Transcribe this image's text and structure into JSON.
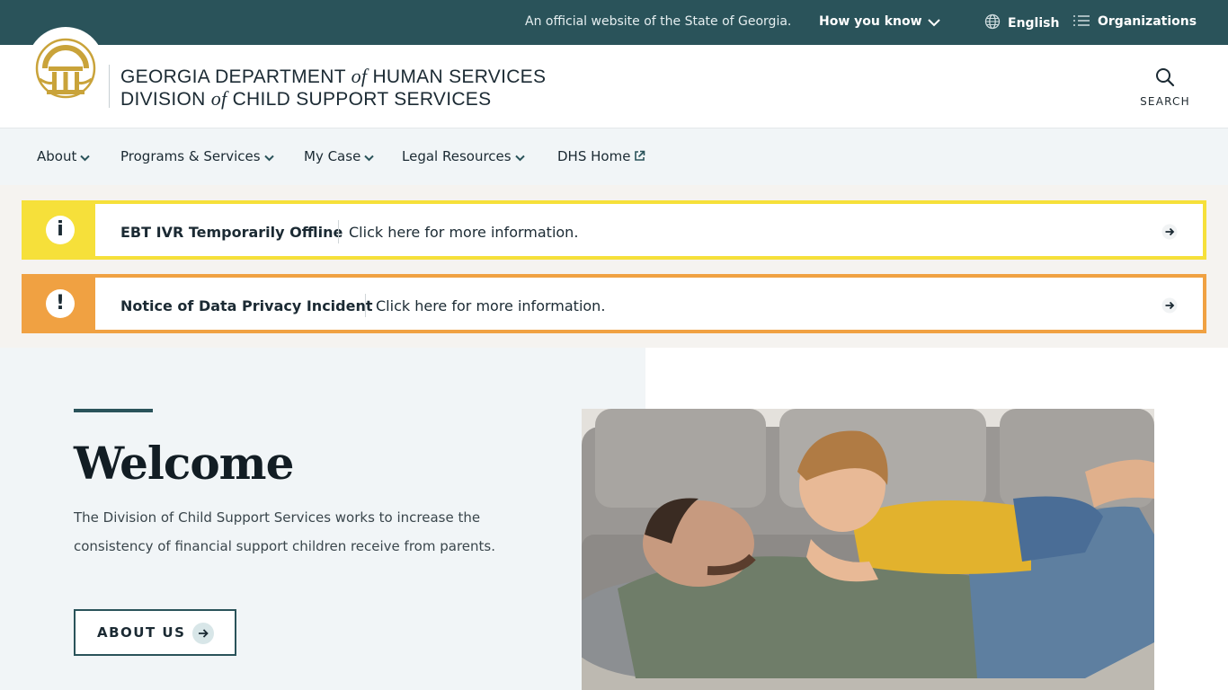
{
  "topbar": {
    "official_text": "An official website of the State of Georgia.",
    "how_you_know": "How you know",
    "language": "English",
    "organizations": "Organizations"
  },
  "header": {
    "line1_a": "GEORGIA DEPARTMENT ",
    "line1_of": "of",
    "line1_b": " HUMAN SERVICES",
    "line2_a": "DIVISION ",
    "line2_of": "of",
    "line2_b": " CHILD SUPPORT SERVICES",
    "search_label": "SEARCH"
  },
  "nav": {
    "items": [
      {
        "label": "About"
      },
      {
        "label": "Programs & Services"
      },
      {
        "label": "My Case"
      },
      {
        "label": "Legal Resources"
      },
      {
        "label": "DHS Home"
      }
    ]
  },
  "alerts": [
    {
      "icon_glyph": "i",
      "headline": "EBT IVR Temporarily Offline",
      "more": "Click here for more information.",
      "color": "#f6e03a"
    },
    {
      "icon_glyph": "!",
      "headline": "Notice of Data Privacy Incident",
      "more": "Click here for more information.",
      "color": "#f0a142"
    }
  ],
  "hero": {
    "title": "Welcome",
    "description": "The Division of Child Support Services works to increase the consistency of financial support children receive from parents.",
    "button_label": "ABOUT US"
  },
  "colors": {
    "brand_teal": "#2a535a",
    "seal_gold": "#c9a33a"
  }
}
